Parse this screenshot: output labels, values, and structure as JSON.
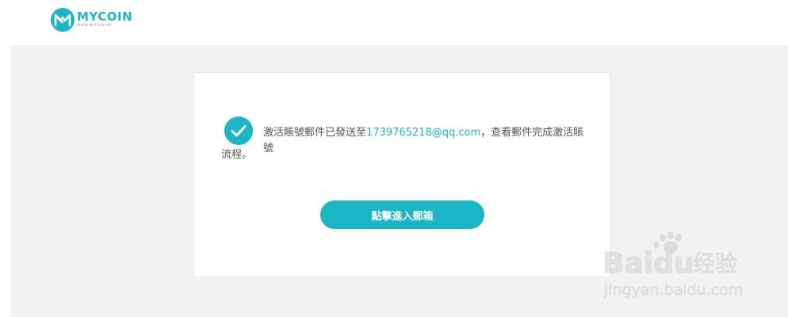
{
  "brand": {
    "name": "MYCOIN",
    "url": "WWW.MYCOIN.HK",
    "color": "#1ab6c6"
  },
  "message": {
    "prefix": "激活賬號郵件已發送至",
    "email": "1739765218@qq.com",
    "suffix": "，查看郵件完成激活賬號",
    "line2": "流程。"
  },
  "button": {
    "label": "點擊進入郵箱"
  },
  "watermark": {
    "brand": "Baidu",
    "brand_cn": "经验",
    "url": "jingyan.baidu.com"
  },
  "icons": {
    "logo": "mycoin-logo-icon",
    "success": "checkmark-icon",
    "watermark": "baidu-paw-icon"
  }
}
